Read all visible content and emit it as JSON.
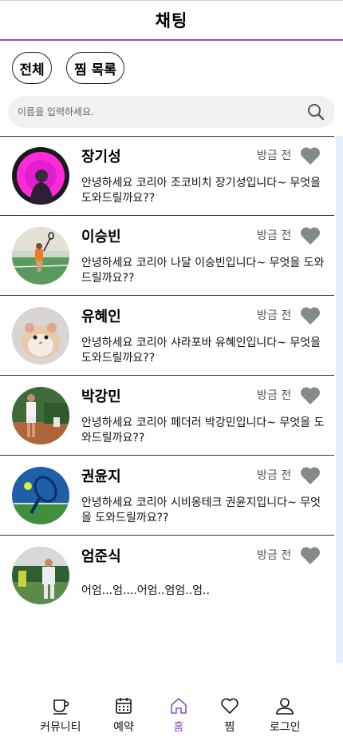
{
  "header": {
    "title": "채팅"
  },
  "filters": {
    "all_label": "전체",
    "favorites_label": "찜 목록"
  },
  "search": {
    "placeholder": "이름을 입력하세요."
  },
  "colors": {
    "accent": "#8a4fd3",
    "heart": "#7f8c88",
    "divider": "#333333"
  },
  "chats": [
    {
      "name": "장기성",
      "time": "방금 전",
      "message": "안녕하세요 코리아 조코비치 장기성입니다~ 무엇을 도와드릴까요??"
    },
    {
      "name": "이승빈",
      "time": "방금 전",
      "message": "안녕하세요 코리아 나달 이승빈입니다~ 무엇을 도와드릴까요??"
    },
    {
      "name": "유혜인",
      "time": "방금 전",
      "message": "안녕하세요 코리아 샤라포바 유혜인입니다~ 무엇을 도와드릴까요??"
    },
    {
      "name": "박강민",
      "time": "방금 전",
      "message": "안녕하세요 코리아 페더러 박강민입니다~ 무엇을 도와드릴까요??"
    },
    {
      "name": "권윤지",
      "time": "방금 전",
      "message": "안녕하세요 코리아 시비옹테크 권윤지입니다~ 무엇을 도와드릴까요??"
    },
    {
      "name": "엄준식",
      "time": "방금 전",
      "message": "어엄...엄....어엄..엄엄..엄.."
    }
  ],
  "nav": {
    "community": "커뮤니티",
    "reservation": "예약",
    "home": "홈",
    "favorites": "찜",
    "login": "로그인"
  }
}
